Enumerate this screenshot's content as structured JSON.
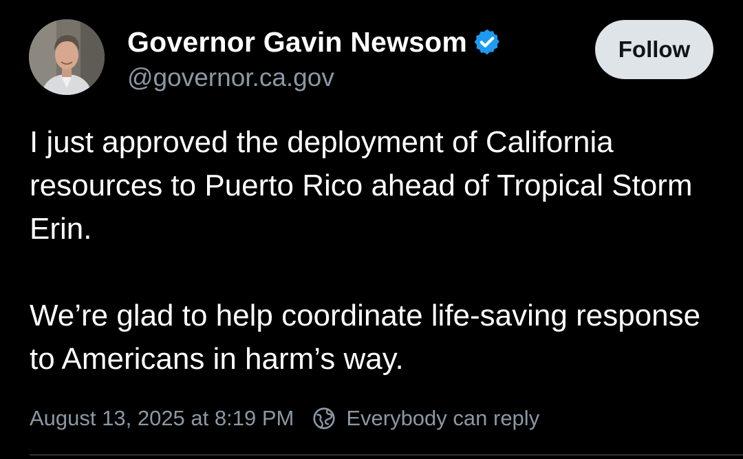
{
  "author": {
    "name": "Governor Gavin Newsom",
    "handle": "@governor.ca.gov",
    "verified": true,
    "avatar_icon": "profile-photo"
  },
  "actions": {
    "follow_label": "Follow"
  },
  "post": {
    "paragraphs": [
      "I just approved the deployment of California resources to Puerto Rico ahead of Tropical Storm Erin.",
      "We’re glad to help coordinate life-saving response to Americans in harm’s way."
    ],
    "timestamp": "August 13, 2025 at 8:19 PM",
    "reply_setting": "Everybody can reply",
    "reply_icon": "globe-icon"
  },
  "colors": {
    "background": "#000000",
    "text": "#ffffff",
    "secondary_text": "#8b98a5",
    "verified_badge": "#1d9bf0",
    "follow_button_bg": "#dfe4e8",
    "follow_button_text": "#0f1419"
  }
}
